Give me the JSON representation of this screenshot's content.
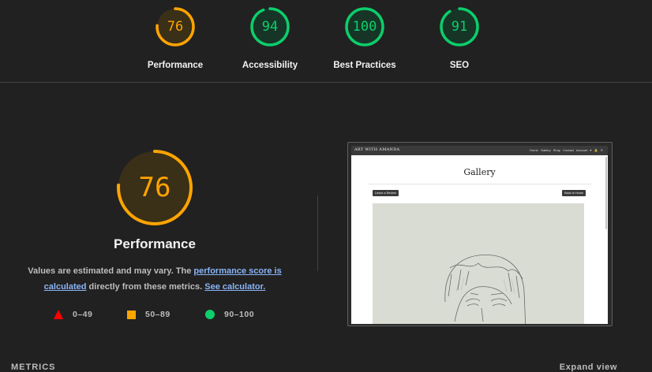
{
  "colors": {
    "pass": "#0cce6b",
    "average": "#ffa400",
    "fail": "#ff0000",
    "link": "#8ab4f8"
  },
  "scores": [
    {
      "label": "Performance",
      "value": "76",
      "fraction": 0.76,
      "color": "#ffa400",
      "track": "#3a2f17"
    },
    {
      "label": "Accessibility",
      "value": "94",
      "fraction": 0.94,
      "color": "#0cce6b",
      "track": "#173527"
    },
    {
      "label": "Best Practices",
      "value": "100",
      "fraction": 1.0,
      "color": "#0cce6b",
      "track": "#173527"
    },
    {
      "label": "SEO",
      "value": "91",
      "fraction": 0.91,
      "color": "#0cce6b",
      "track": "#173527"
    }
  ],
  "main": {
    "value": "76",
    "fraction": 0.76,
    "title": "Performance",
    "desc_text_1": "Values are estimated and may vary. The ",
    "desc_link_1": "performance score is calculated",
    "desc_text_2": " directly from these metrics. ",
    "desc_link_2": "See calculator."
  },
  "legend": {
    "fail": "0–49",
    "average": "50–89",
    "pass": "90–100"
  },
  "screenshot": {
    "brand": "ART WITH AMANDA",
    "nav_links": "Home  Gallery  Shop  Contact  Account ▾  🔒 ✕",
    "title": "Gallery",
    "left_button": "Leave a Review",
    "right_button": "Back to Home"
  },
  "footer": {
    "metrics_label": "METRICS",
    "expand_label": "Expand view"
  }
}
